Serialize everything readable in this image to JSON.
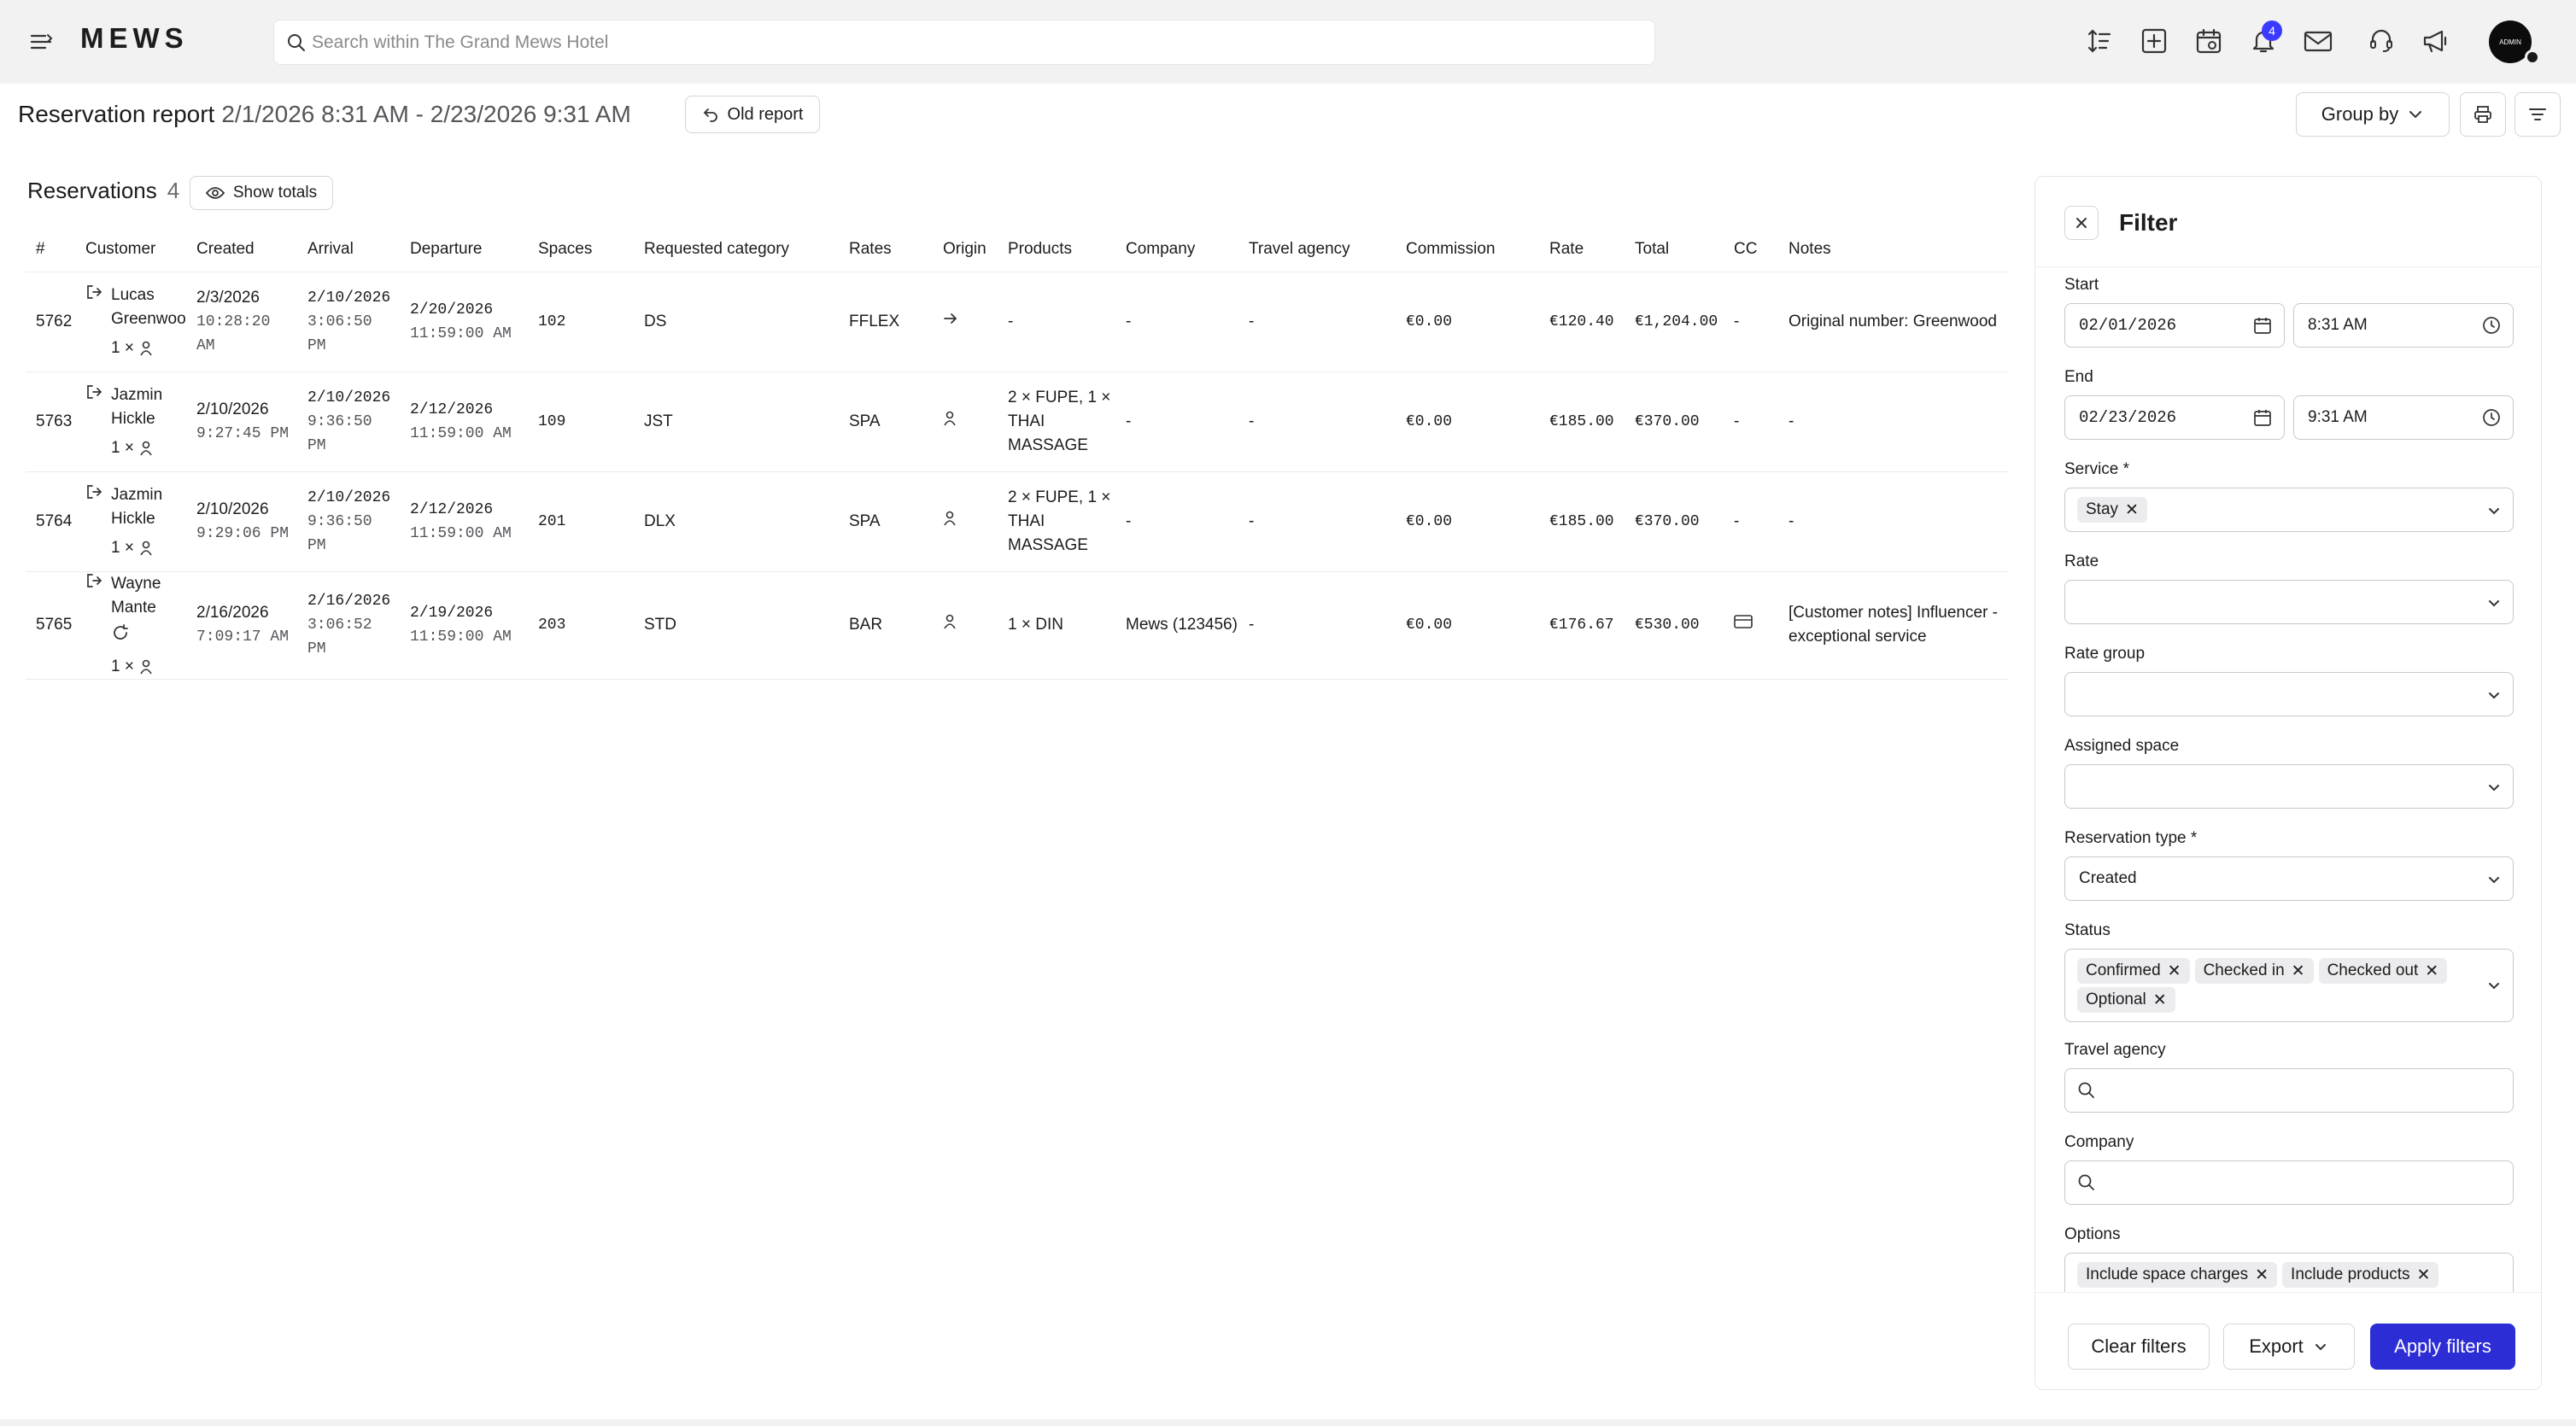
{
  "topbar": {
    "logo": "MEWS",
    "search_placeholder": "Search within The Grand Mews Hotel",
    "notification_count": "4",
    "avatar_label": "ADMIN",
    "icons": [
      "hamburger-icon",
      "search-icon",
      "sort-icon",
      "add-icon",
      "calendar-icon",
      "bell-icon",
      "mail-icon",
      "support-icon",
      "megaphone-icon"
    ]
  },
  "report": {
    "title": "Reservation report",
    "range": "2/1/2026 8:31 AM - 2/23/2026 9:31 AM",
    "old_report": "Old report",
    "group_by": "Group by"
  },
  "reservations": {
    "label": "Reservations",
    "count": "4",
    "show_totals": "Show totals",
    "columns": [
      "#",
      "Customer",
      "Created",
      "Arrival",
      "Departure",
      "Spaces",
      "Requested category",
      "Rates",
      "Origin",
      "Products",
      "Company",
      "Travel agency",
      "Commission",
      "Rate",
      "Total",
      "CC",
      "Notes"
    ],
    "rows": [
      {
        "id": "5762",
        "customer": "Lucas Greenwood",
        "occupancy": "1 ×",
        "created_date": "2/3/2026",
        "created_time": "10:28:20 AM",
        "arrival_date": "2/10/2026",
        "arrival_time": "3:06:50 PM",
        "departure_date": "2/20/2026",
        "departure_time": "11:59:00 AM",
        "space": "102",
        "category": "DS",
        "rate_code": "FFLEX",
        "origin": "arrow",
        "products": "-",
        "company": "-",
        "travel_agency": "-",
        "commission": "€0.00",
        "rate": "€120.40",
        "total": "€1,204.00",
        "cc": "-",
        "notes": "Original number: Greenwood"
      },
      {
        "id": "5763",
        "customer": "Jazmin Hickle",
        "occupancy": "1 ×",
        "created_date": "2/10/2026",
        "created_time": "9:27:45 PM",
        "arrival_date": "2/10/2026",
        "arrival_time": "9:36:50 PM",
        "departure_date": "2/12/2026",
        "departure_time": "11:59:00 AM",
        "space": "109",
        "category": "JST",
        "rate_code": "SPA",
        "origin": "person",
        "products": "2 × FUPE, 1 × THAI MASSAGE",
        "company": "-",
        "travel_agency": "-",
        "commission": "€0.00",
        "rate": "€185.00",
        "total": "€370.00",
        "cc": "-",
        "notes": "-"
      },
      {
        "id": "5764",
        "customer": "Jazmin Hickle",
        "occupancy": "1 ×",
        "created_date": "2/10/2026",
        "created_time": "9:29:06 PM",
        "arrival_date": "2/10/2026",
        "arrival_time": "9:36:50 PM",
        "departure_date": "2/12/2026",
        "departure_time": "11:59:00 AM",
        "space": "201",
        "category": "DLX",
        "rate_code": "SPA",
        "origin": "person",
        "products": "2 × FUPE, 1 × THAI MASSAGE",
        "company": "-",
        "travel_agency": "-",
        "commission": "€0.00",
        "rate": "€185.00",
        "total": "€370.00",
        "cc": "-",
        "notes": "-"
      },
      {
        "id": "5765",
        "customer": "Wayne Mante",
        "occupancy": "1 ×",
        "created_date": "2/16/2026",
        "created_time": "7:09:17 AM",
        "arrival_date": "2/16/2026",
        "arrival_time": "3:06:52 PM",
        "departure_date": "2/19/2026",
        "departure_time": "11:59:00 AM",
        "space": "203",
        "category": "STD",
        "rate_code": "BAR",
        "origin": "person",
        "products": "1 × DIN",
        "company": "Mews (123456)",
        "travel_agency": "-",
        "commission": "€0.00",
        "rate": "€176.67",
        "total": "€530.00",
        "cc": "card",
        "notes": "[Customer notes] Influencer - exceptional service"
      }
    ]
  },
  "filter": {
    "title": "Filter",
    "start_label": "Start",
    "start_date": "02/01/2026",
    "start_time": "8:31 AM",
    "end_label": "End",
    "end_date": "02/23/2026",
    "end_time": "9:31 AM",
    "service_label": "Service *",
    "service_chip": "Stay",
    "rate_label": "Rate",
    "rate_group_label": "Rate group",
    "assigned_space_label": "Assigned space",
    "reservation_type_label": "Reservation type *",
    "reservation_type_value": "Created",
    "status_label": "Status",
    "status_chips": [
      "Confirmed",
      "Checked in",
      "Checked out",
      "Optional"
    ],
    "travel_agency_label": "Travel agency",
    "company_label": "Company",
    "options_label": "Options",
    "option_chips": [
      "Include space charges",
      "Include products"
    ],
    "clear_filters": "Clear filters",
    "export": "Export",
    "apply_filters": "Apply filters"
  },
  "colors": {
    "accent": "#2d2dd6",
    "badge": "#3b3bff",
    "chrome_bg": "#f2f2f2",
    "chip_bg": "#ececee"
  }
}
